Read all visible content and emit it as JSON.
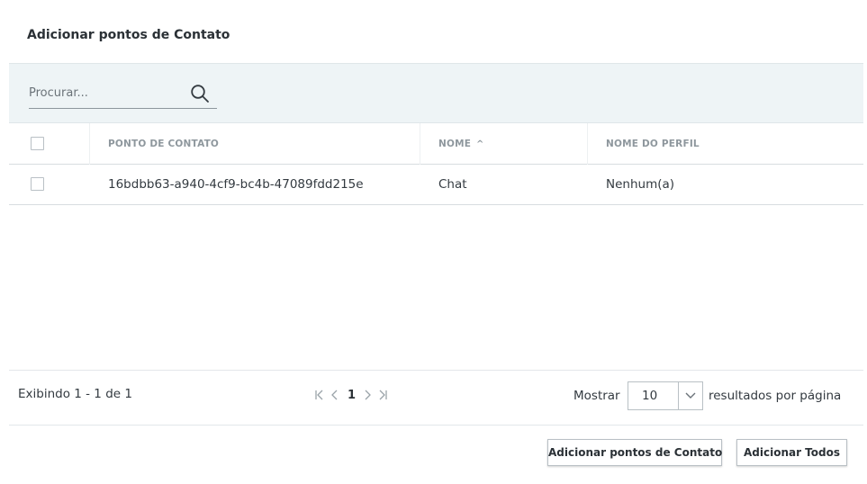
{
  "dialog": {
    "title": "Adicionar pontos de Contato"
  },
  "search": {
    "placeholder": "Procurar..."
  },
  "table": {
    "columns": {
      "contact_point": "PONTO DE CONTATO",
      "name": "NOME",
      "name_sort_indicator": "^",
      "profile_name": "NOME DO PERFIL"
    },
    "rows": [
      {
        "contact_point": "16bdbb63-a940-4cf9-bc4b-47089fdd215e",
        "name": "Chat",
        "profile_name": "Nenhum(a)",
        "checked": false
      }
    ]
  },
  "footer": {
    "showing": "Exibindo 1 - 1 de 1",
    "current_page": "1",
    "show_label": "Mostrar",
    "per_page_value": "10",
    "per_page_label": "resultados por página"
  },
  "actions": {
    "add_label": "Adicionar pontos de Contato",
    "add_all_label": "Adicionar Todos"
  },
  "icons": {
    "search": "search-icon",
    "sort": "sort-ascending-icon",
    "first_page": "first-page-icon",
    "prev_page": "prev-page-icon",
    "next_page": "next-page-icon",
    "last_page": "last-page-icon",
    "dropdown": "chevron-down-icon"
  },
  "colors": {
    "search_bar_bg": "#eef4f6",
    "header_text": "#8e979d",
    "text": "#333a40",
    "border": "#b9c0c5"
  }
}
